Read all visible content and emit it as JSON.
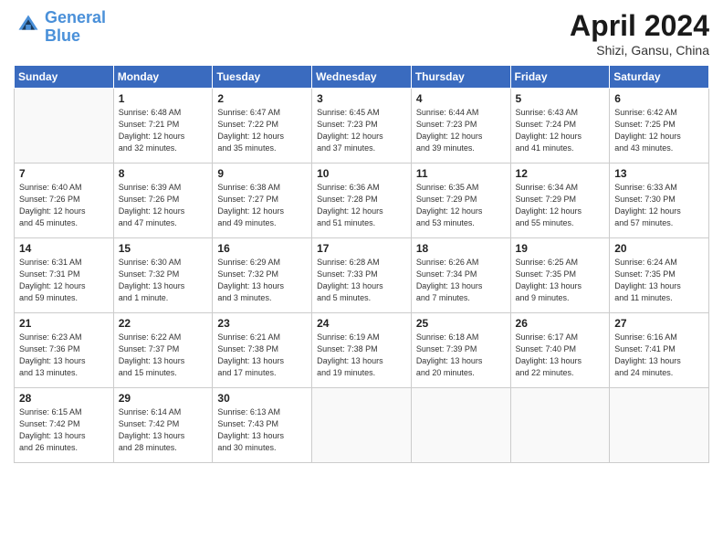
{
  "header": {
    "logo_line1": "General",
    "logo_line2": "Blue",
    "month": "April 2024",
    "location": "Shizi, Gansu, China"
  },
  "weekdays": [
    "Sunday",
    "Monday",
    "Tuesday",
    "Wednesday",
    "Thursday",
    "Friday",
    "Saturday"
  ],
  "weeks": [
    [
      {
        "day": "",
        "info": ""
      },
      {
        "day": "1",
        "info": "Sunrise: 6:48 AM\nSunset: 7:21 PM\nDaylight: 12 hours\nand 32 minutes."
      },
      {
        "day": "2",
        "info": "Sunrise: 6:47 AM\nSunset: 7:22 PM\nDaylight: 12 hours\nand 35 minutes."
      },
      {
        "day": "3",
        "info": "Sunrise: 6:45 AM\nSunset: 7:23 PM\nDaylight: 12 hours\nand 37 minutes."
      },
      {
        "day": "4",
        "info": "Sunrise: 6:44 AM\nSunset: 7:23 PM\nDaylight: 12 hours\nand 39 minutes."
      },
      {
        "day": "5",
        "info": "Sunrise: 6:43 AM\nSunset: 7:24 PM\nDaylight: 12 hours\nand 41 minutes."
      },
      {
        "day": "6",
        "info": "Sunrise: 6:42 AM\nSunset: 7:25 PM\nDaylight: 12 hours\nand 43 minutes."
      }
    ],
    [
      {
        "day": "7",
        "info": "Sunrise: 6:40 AM\nSunset: 7:26 PM\nDaylight: 12 hours\nand 45 minutes."
      },
      {
        "day": "8",
        "info": "Sunrise: 6:39 AM\nSunset: 7:26 PM\nDaylight: 12 hours\nand 47 minutes."
      },
      {
        "day": "9",
        "info": "Sunrise: 6:38 AM\nSunset: 7:27 PM\nDaylight: 12 hours\nand 49 minutes."
      },
      {
        "day": "10",
        "info": "Sunrise: 6:36 AM\nSunset: 7:28 PM\nDaylight: 12 hours\nand 51 minutes."
      },
      {
        "day": "11",
        "info": "Sunrise: 6:35 AM\nSunset: 7:29 PM\nDaylight: 12 hours\nand 53 minutes."
      },
      {
        "day": "12",
        "info": "Sunrise: 6:34 AM\nSunset: 7:29 PM\nDaylight: 12 hours\nand 55 minutes."
      },
      {
        "day": "13",
        "info": "Sunrise: 6:33 AM\nSunset: 7:30 PM\nDaylight: 12 hours\nand 57 minutes."
      }
    ],
    [
      {
        "day": "14",
        "info": "Sunrise: 6:31 AM\nSunset: 7:31 PM\nDaylight: 12 hours\nand 59 minutes."
      },
      {
        "day": "15",
        "info": "Sunrise: 6:30 AM\nSunset: 7:32 PM\nDaylight: 13 hours\nand 1 minute."
      },
      {
        "day": "16",
        "info": "Sunrise: 6:29 AM\nSunset: 7:32 PM\nDaylight: 13 hours\nand 3 minutes."
      },
      {
        "day": "17",
        "info": "Sunrise: 6:28 AM\nSunset: 7:33 PM\nDaylight: 13 hours\nand 5 minutes."
      },
      {
        "day": "18",
        "info": "Sunrise: 6:26 AM\nSunset: 7:34 PM\nDaylight: 13 hours\nand 7 minutes."
      },
      {
        "day": "19",
        "info": "Sunrise: 6:25 AM\nSunset: 7:35 PM\nDaylight: 13 hours\nand 9 minutes."
      },
      {
        "day": "20",
        "info": "Sunrise: 6:24 AM\nSunset: 7:35 PM\nDaylight: 13 hours\nand 11 minutes."
      }
    ],
    [
      {
        "day": "21",
        "info": "Sunrise: 6:23 AM\nSunset: 7:36 PM\nDaylight: 13 hours\nand 13 minutes."
      },
      {
        "day": "22",
        "info": "Sunrise: 6:22 AM\nSunset: 7:37 PM\nDaylight: 13 hours\nand 15 minutes."
      },
      {
        "day": "23",
        "info": "Sunrise: 6:21 AM\nSunset: 7:38 PM\nDaylight: 13 hours\nand 17 minutes."
      },
      {
        "day": "24",
        "info": "Sunrise: 6:19 AM\nSunset: 7:38 PM\nDaylight: 13 hours\nand 19 minutes."
      },
      {
        "day": "25",
        "info": "Sunrise: 6:18 AM\nSunset: 7:39 PM\nDaylight: 13 hours\nand 20 minutes."
      },
      {
        "day": "26",
        "info": "Sunrise: 6:17 AM\nSunset: 7:40 PM\nDaylight: 13 hours\nand 22 minutes."
      },
      {
        "day": "27",
        "info": "Sunrise: 6:16 AM\nSunset: 7:41 PM\nDaylight: 13 hours\nand 24 minutes."
      }
    ],
    [
      {
        "day": "28",
        "info": "Sunrise: 6:15 AM\nSunset: 7:42 PM\nDaylight: 13 hours\nand 26 minutes."
      },
      {
        "day": "29",
        "info": "Sunrise: 6:14 AM\nSunset: 7:42 PM\nDaylight: 13 hours\nand 28 minutes."
      },
      {
        "day": "30",
        "info": "Sunrise: 6:13 AM\nSunset: 7:43 PM\nDaylight: 13 hours\nand 30 minutes."
      },
      {
        "day": "",
        "info": ""
      },
      {
        "day": "",
        "info": ""
      },
      {
        "day": "",
        "info": ""
      },
      {
        "day": "",
        "info": ""
      }
    ]
  ]
}
